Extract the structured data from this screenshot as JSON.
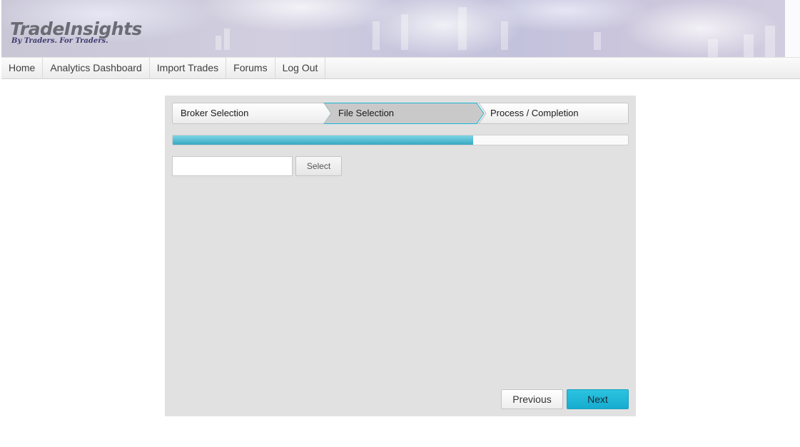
{
  "brand": {
    "name": "TradeInsights",
    "tagline": "By Traders. For Traders."
  },
  "nav": {
    "items": [
      {
        "label": "Home"
      },
      {
        "label": "Analytics Dashboard"
      },
      {
        "label": "Import Trades"
      },
      {
        "label": "Forums"
      },
      {
        "label": "Log Out"
      }
    ]
  },
  "wizard": {
    "steps": [
      {
        "label": "Broker Selection",
        "state": "completed"
      },
      {
        "label": "File Selection",
        "state": "active"
      },
      {
        "label": "Process / Completion",
        "state": "pending"
      }
    ],
    "progress_fraction": 0.66,
    "file_input": {
      "value": "",
      "placeholder": ""
    },
    "select_label": "Select",
    "previous_label": "Previous",
    "next_label": "Next"
  },
  "colors": {
    "accent": "#1bb6d6",
    "progress_fill": "#3fb4cc",
    "active_step": "#c9c9c9",
    "panel_bg": "#e1e1e1",
    "brand_text": "#6b6b73",
    "tagline_text": "#3e3a6e"
  }
}
